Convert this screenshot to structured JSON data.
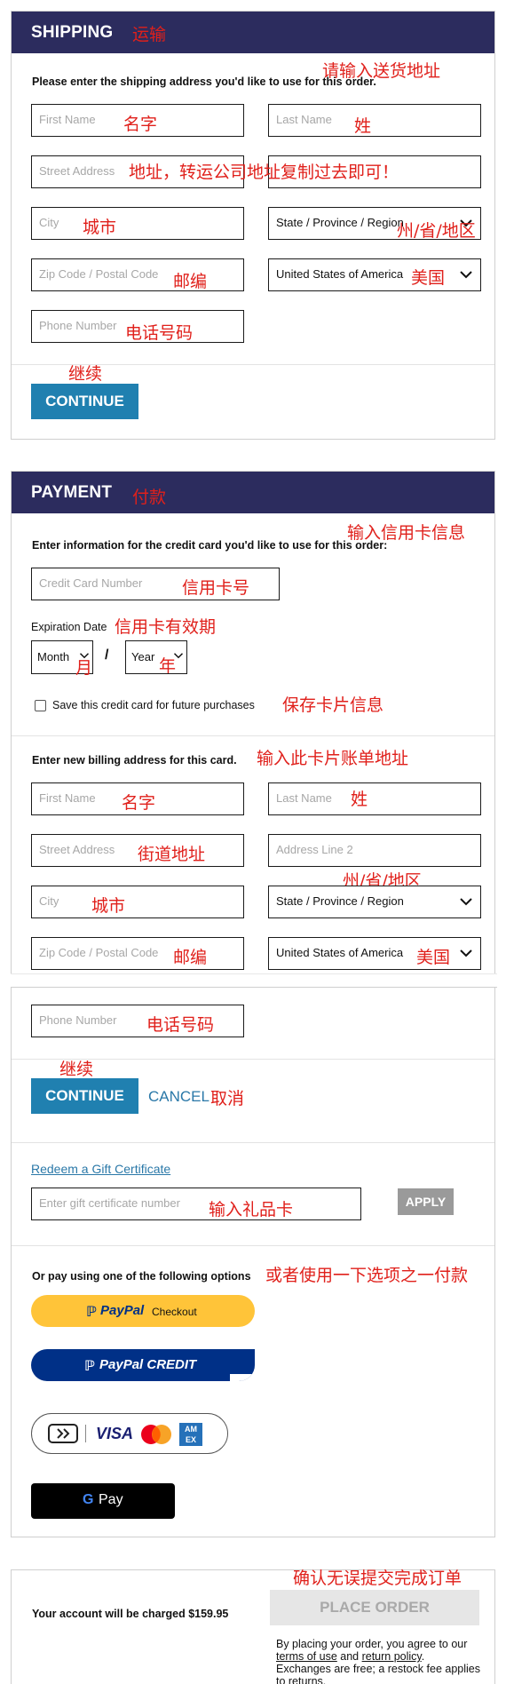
{
  "shipping": {
    "title": "SHIPPING",
    "title_note": "运输",
    "note_enter_address": "请输入送货地址",
    "instruction": "Please enter the shipping address you'd like to use for this order.",
    "first_name_ph": "First Name",
    "first_name_note": "名字",
    "last_name_ph": "Last Name",
    "last_name_note": "姓",
    "street_ph": "Street Address",
    "street_note": "地址，转运公司地址复制过去即可！",
    "city_ph": "City",
    "city_note": "城市",
    "state_value": "State / Province / Region",
    "state_note": "州/省/地区",
    "zip_ph": "Zip Code / Postal Code",
    "zip_note": "邮编",
    "country_value": "United States of America",
    "country_note": "美国",
    "phone_ph": "Phone Number",
    "phone_note": "电话号码",
    "continue_note": "继续",
    "continue_label": "CONTINUE"
  },
  "payment": {
    "title": "PAYMENT",
    "title_note": "付款",
    "note_enter_card": "输入信用卡信息",
    "instruction": "Enter information for the credit card you'd like to use for this order:",
    "card_number_ph": "Credit Card Number",
    "card_number_note": "信用卡号",
    "expiration_label": "Expiration Date",
    "expiration_note": "信用卡有效期",
    "month_value": "Month",
    "month_note": "月",
    "slash": "/",
    "year_value": "Year",
    "year_note": "年",
    "save_card_label": "Save this credit card for future purchases",
    "save_card_note": "保存卡片信息",
    "billing_instruction": "Enter new billing address for this card.",
    "billing_note": "输入此卡片账单地址",
    "first_name_ph": "First Name",
    "first_name_note": "名字",
    "last_name_ph": "Last Name",
    "last_name_note": "姓",
    "street_ph": "Street Address",
    "street_note": "街道地址",
    "address2_ph": "Address Line 2",
    "city_ph": "City",
    "city_note": "城市",
    "state_value": "State / Province / Region",
    "state_note": "州/省/地区",
    "zip_ph": "Zip Code / Postal Code",
    "zip_note": "邮编",
    "country_value": "United States of America",
    "country_note": "美国",
    "phone_ph": "Phone Number",
    "phone_note": "电话号码",
    "continue_note": "继续",
    "continue_label": "CONTINUE",
    "cancel_label": "CANCEL",
    "cancel_note": "取消",
    "redeem_label": "Redeem a Gift Certificate",
    "gift_ph": "Enter gift certificate number",
    "gift_note": "输入礼品卡",
    "apply_label": "APPLY",
    "alt_pay_label": "Or pay using one of the following options",
    "alt_pay_note": "或者使用一下选项之一付款",
    "paypal_brand": "PayPal",
    "paypal_checkout": "Checkout",
    "paypal_credit": "PayPal CREDIT",
    "visa_label": "VISA",
    "amex_label": "AM EX",
    "gpay_label": "Pay"
  },
  "order": {
    "note_confirm": "确认无误提交完成订单",
    "charge_text": "Your account will be charged $159.95",
    "place_order_label": "PLACE ORDER",
    "terms_prefix": "By placing your order, you agree to our ",
    "terms_link": "terms of use",
    "terms_and": " and ",
    "return_link": "return policy",
    "terms_suffix": ". Exchanges are free; a restock fee applies to returns."
  },
  "colors": {
    "header_bg": "#2c2c5e",
    "accent": "#2080b0",
    "annotation": "#e0201b",
    "paypal_yellow": "#ffc439",
    "paypal_navy": "#003087"
  }
}
